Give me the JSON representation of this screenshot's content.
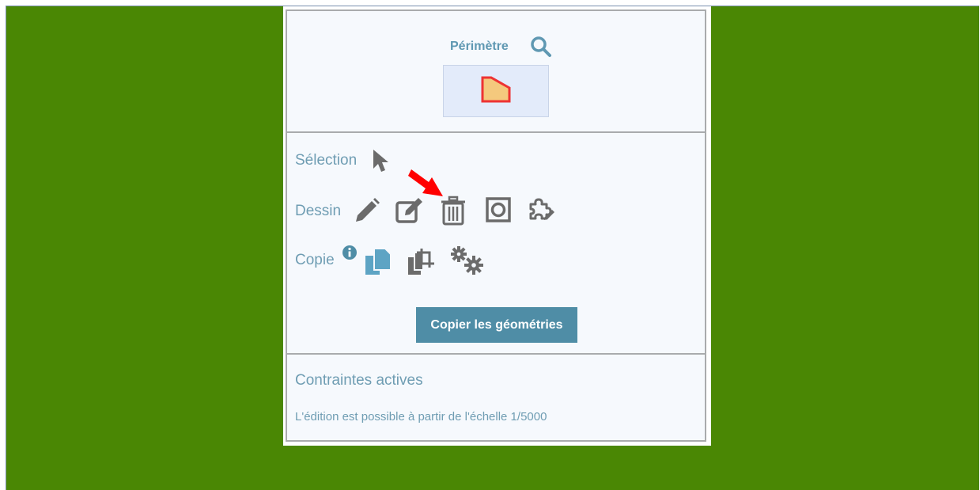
{
  "perimetre": {
    "title": "Périmètre",
    "search_icon": "search-icon",
    "shape_icon": "polygon-icon"
  },
  "tools": {
    "selection_label": "Sélection",
    "drawing_label": "Dessin",
    "copy_label": "Copie"
  },
  "icons": {
    "selection": "cursor-arrow-icon",
    "draw": "pencil-icon",
    "edit": "edit-square-icon",
    "delete": "trash-icon",
    "hole": "square-ring-icon",
    "puzzle": "puzzle-edit-icon",
    "info": "info-icon",
    "copy": "copy-icon",
    "crop": "copy-crop-icon",
    "settings": "gears-icon"
  },
  "copy_button": "Copier les géométries",
  "constraints": {
    "title": "Contraintes actives",
    "text": "L'édition est possible à partir de l'échelle 1/5000"
  },
  "colors": {
    "background_green": "#4a8704",
    "panel": "#f6f9fd",
    "accent_text": "#6f9db3",
    "button": "#4f8da6",
    "icon_gray": "#6b6b6b",
    "icon_blue": "#5da4c4",
    "annotation_red": "#ff0000"
  }
}
